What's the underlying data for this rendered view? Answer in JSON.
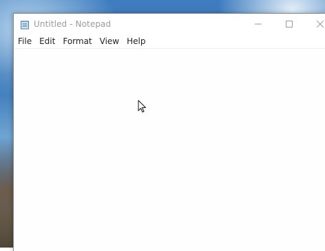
{
  "window": {
    "title": "Untitled - Notepad"
  },
  "titlebar": {
    "app_icon": "notepad-icon",
    "minimize_icon": "minimize-icon",
    "maximize_icon": "maximize-icon",
    "close_icon": "close-icon"
  },
  "menu": {
    "items": [
      {
        "label": "File"
      },
      {
        "label": "Edit"
      },
      {
        "label": "Format"
      },
      {
        "label": "View"
      },
      {
        "label": "Help"
      }
    ]
  },
  "editor": {
    "text": ""
  },
  "pointer": {
    "icon": "arrow-cursor-icon"
  }
}
